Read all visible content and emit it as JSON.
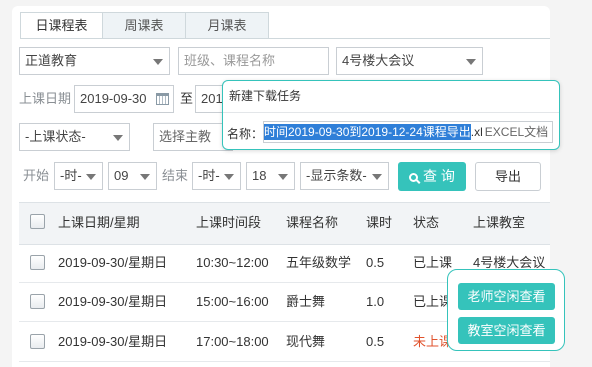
{
  "tabs": [
    "日课程表",
    "周课表",
    "月课表"
  ],
  "filters": {
    "org": "正道教育",
    "class_course_placeholder": "班级、课程名称",
    "room": "4号楼大会议",
    "date_label": "上课日期",
    "date_from": "2019-09-30",
    "date_to_label": "至",
    "date_to": "2019",
    "status": "-上课状态-",
    "teacher_placeholder": "选择主教",
    "start_label": "开始",
    "start_hour": "-时-",
    "start_minute": "09",
    "end_label": "结束",
    "end_hour": "-时-",
    "end_minute": "18",
    "page_size": "-显示条数-",
    "search_label": "查 询",
    "export_label": "导出"
  },
  "table": {
    "headers": [
      "上课日期/星期",
      "上课时间段",
      "课程名称",
      "课时",
      "状态",
      "上课教室"
    ],
    "rows": [
      {
        "date": "2019-09-30/星期日",
        "time": "10:30~12:00",
        "course": "五年级数学",
        "hours": "0.5",
        "status": "已上课",
        "room": "4号楼大会议"
      },
      {
        "date": "2019-09-30/星期日",
        "time": "15:00~16:00",
        "course": "爵士舞",
        "hours": "1.0",
        "status": "已上课",
        "room": ""
      },
      {
        "date": "2019-09-30/星期日",
        "time": "17:00~18:00",
        "course": "现代舞",
        "hours": "0.5",
        "status": "未上课",
        "room": ""
      }
    ]
  },
  "popup": {
    "title": "新建下载任务",
    "name_label": "名称：",
    "filename_selected": "时间2019-09-30到2019-12-24课程导出",
    "filename_ext": ".xl",
    "filetype": "EXCEL文档"
  },
  "float": {
    "teacher_free": "老师空闲查看",
    "room_free": "教室空闲查看"
  },
  "colors": {
    "accent": "#35c3bb",
    "not_started": "#e0522c"
  }
}
